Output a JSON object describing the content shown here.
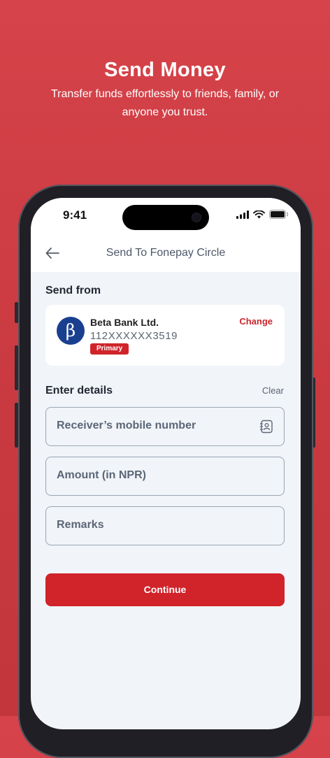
{
  "promo": {
    "title": "Send Money",
    "subtitle": "Transfer funds effortlessly to friends, family, or anyone you trust."
  },
  "status_bar": {
    "time": "9:41"
  },
  "header": {
    "back_icon": "arrow-left-icon",
    "title": "Send To Fonepay Circle"
  },
  "send_from": {
    "label": "Send from",
    "bank_logo_glyph": "β",
    "bank_name": "Beta Bank Ltd.",
    "account_number": "112XXXXXX3519",
    "badge": "Primary",
    "change_label": "Change"
  },
  "details": {
    "label": "Enter details",
    "clear_label": "Clear",
    "receiver_placeholder": "Receiver’s mobile number",
    "amount_placeholder": "Amount (in NPR)",
    "remarks_placeholder": "Remarks"
  },
  "continue_label": "Continue",
  "colors": {
    "brand_red": "#d0232a",
    "background": "#c93a40",
    "bank_blue": "#1a3f8f"
  }
}
